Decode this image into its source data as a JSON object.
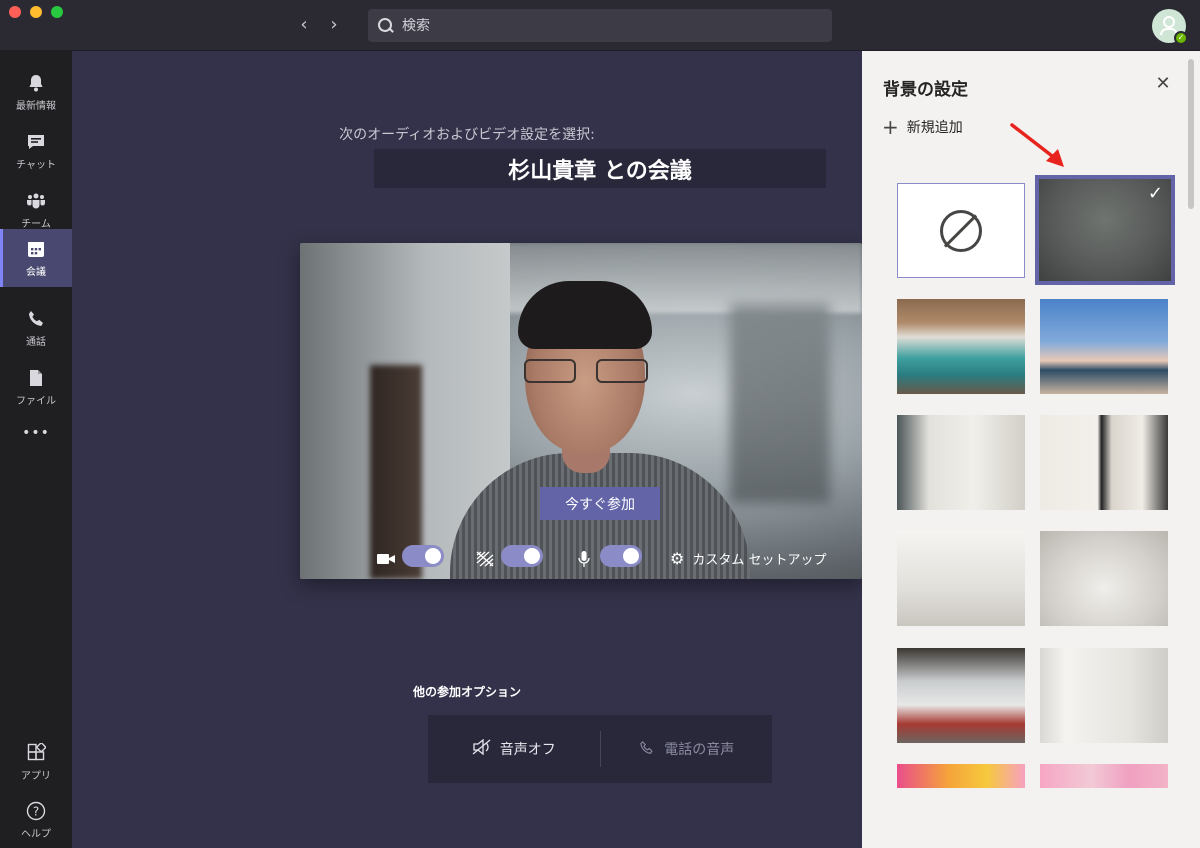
{
  "titlebar": {
    "search_placeholder": "検索"
  },
  "sidebar": {
    "items": [
      {
        "label": "最新情報"
      },
      {
        "label": "チャット"
      },
      {
        "label": "チーム"
      },
      {
        "label": "会議"
      },
      {
        "label": "通話"
      },
      {
        "label": "ファイル"
      },
      {
        "label": "•••"
      },
      {
        "label": "アプリ"
      },
      {
        "label": "ヘルプ"
      }
    ]
  },
  "main": {
    "subtitle": "次のオーディオおよびビデオ設定を選択:",
    "meeting_title": "杉山貴章 との会議",
    "join_label": "今すぐ参加",
    "custom_setup_label": "カスタム セットアップ",
    "other_options_title": "他の参加オプション",
    "audio_off_label": "音声オフ",
    "phone_audio_label": "電話の音声"
  },
  "panel": {
    "title": "背景の設定",
    "add_new_label": "新規追加"
  },
  "colors": {
    "accent": "#6264a7",
    "toggle": "#8b8cc7",
    "arrow": "#e8231d"
  }
}
